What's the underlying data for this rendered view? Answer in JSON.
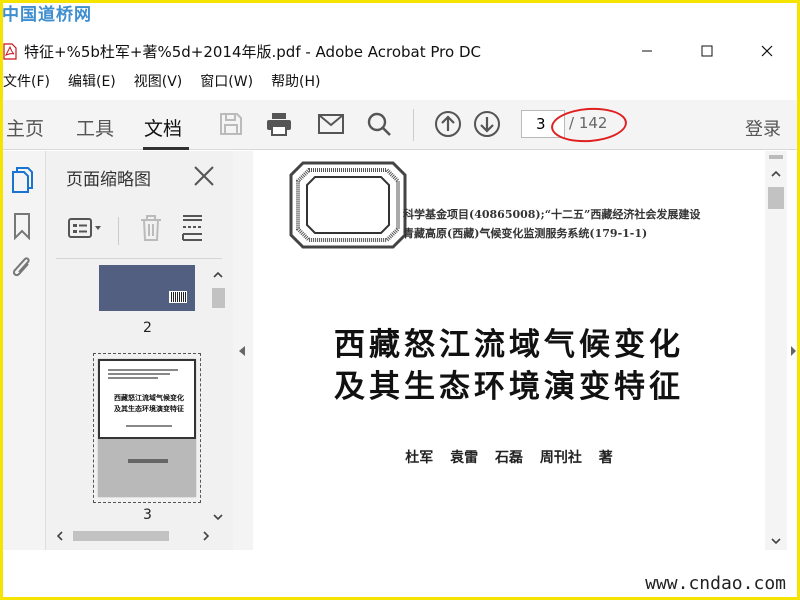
{
  "watermark_top": "中国道桥网",
  "watermark_bottom": "www.cndao.com",
  "window": {
    "title": "特征+%5b杜军+著%5d+2014年版.pdf - Adobe Acrobat Pro DC"
  },
  "menu": [
    "文件(F)",
    "编辑(E)",
    "视图(V)",
    "窗口(W)",
    "帮助(H)"
  ],
  "toolbar": {
    "tabs": [
      "主页",
      "工具",
      "文档"
    ],
    "active_tab": "文档",
    "page_current": "3",
    "page_total": "/ 142",
    "login": "登录",
    "icons": [
      "save-icon",
      "print-icon",
      "email-icon",
      "search-icon",
      "page-up-icon",
      "page-down-icon"
    ]
  },
  "left_rail": {
    "icons": [
      "pages-icon",
      "bookmark-icon",
      "attachment-icon"
    ]
  },
  "thumbnails_panel": {
    "title": "页面缩略图",
    "pages": [
      {
        "label": "2"
      },
      {
        "label": "3",
        "title_lines": [
          "西藏怒江流域气候变化",
          "及其生态环境演变特征"
        ]
      }
    ]
  },
  "document": {
    "funding_lines": [
      "科学基金项目(40865008);“十二五”西藏经济社会发展建设",
      "青藏高原(西藏)气候变化监测服务系统(179-1-1)"
    ],
    "title_lines": [
      "西藏怒江流域气候变化",
      "及其生态环境演变特征"
    ],
    "authors": "杜军 袁雷 石磊 周刊社 著"
  },
  "colors": {
    "frame": "#f5e400",
    "watermark": "#3e8ed0",
    "highlight": "#e02020",
    "thumb2_cover": "#525f80"
  }
}
